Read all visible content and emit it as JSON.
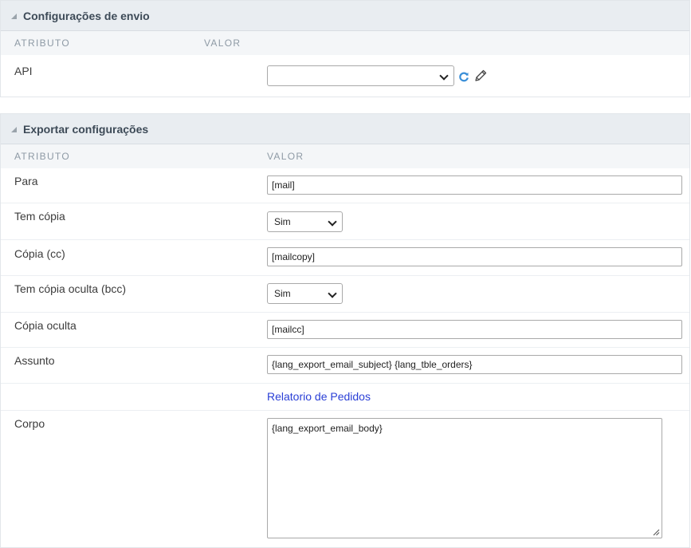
{
  "section1": {
    "title": "Configurações de envio",
    "col_attr": "ATRIBUTO",
    "col_value": "VALOR",
    "rows": [
      {
        "label": "API",
        "value": ""
      }
    ]
  },
  "section2": {
    "title": "Exportar configurações",
    "col_attr": "ATRIBUTO",
    "col_value": "VALOR",
    "para": {
      "label": "Para",
      "value": "[mail]"
    },
    "tem_copia": {
      "label": "Tem cópia",
      "value": "Sim"
    },
    "copia_cc": {
      "label": "Cópia (cc)",
      "value": "[mailcopy]"
    },
    "tem_copia_oculta": {
      "label": "Tem cópia oculta (bcc)",
      "value": "Sim"
    },
    "copia_oculta": {
      "label": "Cópia oculta",
      "value": "[mailcc]"
    },
    "assunto": {
      "label": "Assunto",
      "value": "{lang_export_email_subject} {lang_tble_orders}"
    },
    "link": "Relatorio de Pedidos",
    "corpo": {
      "label": "Corpo",
      "value": "{lang_export_email_body}"
    }
  },
  "colors": {
    "header_bg": "#e9edf1",
    "link": "#2a3fd6",
    "refresh_icon": "#3a8fd8"
  }
}
